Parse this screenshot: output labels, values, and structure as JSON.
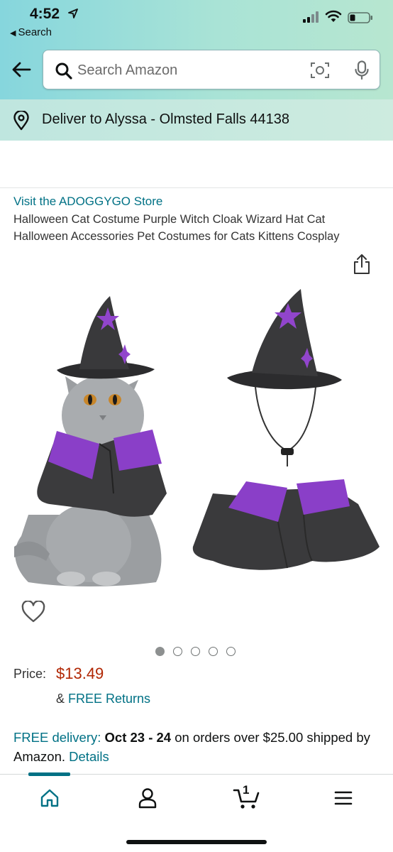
{
  "status_bar": {
    "time": "4:52",
    "back_app_label": "Search"
  },
  "header": {
    "search_placeholder": "Search Amazon"
  },
  "delivery_bar": {
    "text": "Deliver to Alyssa - Olmsted Falls 44138"
  },
  "product": {
    "store_link": "Visit the ADOGGYGO Store",
    "title": "Halloween Cat Costume Purple Witch Cloak Wizard Hat Cat Halloween Accessories Pet Costumes for Cats Kittens Cosplay",
    "image_count": 5,
    "active_image_index": 0,
    "price_label": "Price:",
    "price": "$13.49",
    "returns_prefix": "& ",
    "returns_link": "FREE Returns",
    "delivery_prefix": "FREE delivery: ",
    "delivery_dates": "Oct 23 - 24",
    "delivery_suffix": " on orders over $25.00 shipped by Amazon. ",
    "delivery_link": "Details"
  },
  "bottom_nav": {
    "cart_count": "1",
    "items": [
      "home-icon",
      "account-icon",
      "cart-icon",
      "menu-icon"
    ]
  },
  "colors": {
    "link": "#007185",
    "price": "#b12704",
    "header_gradient_start": "#86d6dd",
    "header_gradient_end": "#b7e6d0",
    "costume_purple": "#8a3fc8"
  }
}
